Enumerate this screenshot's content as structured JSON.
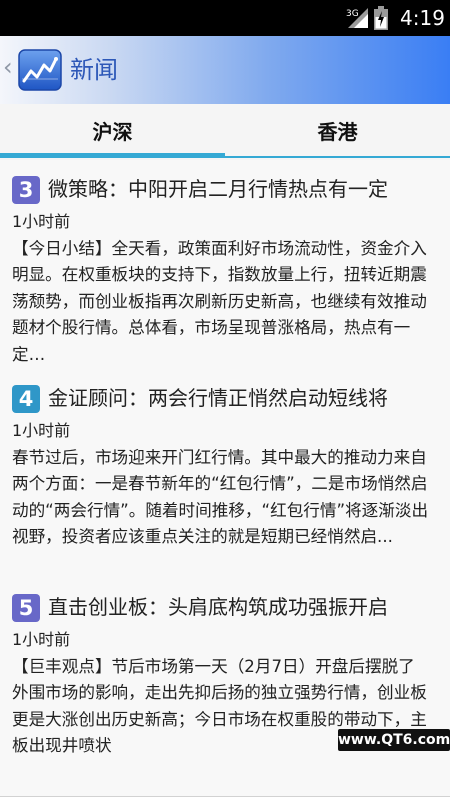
{
  "status_bar": {
    "network": "3G",
    "time": "4:19"
  },
  "header": {
    "title": "新闻",
    "back_icon": "chevron-left-icon",
    "logo_icon": "stock-chart-icon"
  },
  "tabs": [
    {
      "label": "沪深",
      "selected": true
    },
    {
      "label": "香港",
      "selected": false
    }
  ],
  "colors": {
    "tab_indicator": "#35a9d4"
  },
  "news": [
    {
      "number": "3",
      "badge_color": "#6868c8",
      "headline": "微策略：中阳开启二月行情热点有一定",
      "time": "1小时前",
      "summary": "【今日小结】全天看，政策面利好市场流动性，资金介入明显。在权重板块的支持下，指数放量上行，扭转近期震荡颓势，而创业板指再次刷新历史新高，也继续有效推动题材个股行情。总体看，市场呈现普涨格局，热点有一定…"
    },
    {
      "number": "4",
      "badge_color": "#2f97c8",
      "headline": "金证顾问：两会行情正悄然启动短线将",
      "time": "1小时前",
      "summary": "春节过后，市场迎来开门红行情。其中最大的推动力来自两个方面：一是春节新年的“红包行情”，二是市场悄然启动的“两会行情”。随着时间推移，“红包行情”将逐渐淡出视野，投资者应该重点关注的就是短期已经悄然启..."
    },
    {
      "number": "5",
      "badge_color": "#6868c8",
      "headline": "直击创业板：头肩底构筑成功强振开启",
      "time": "1小时前",
      "summary": "【巨丰观点】节后市场第一天（2月7日）开盘后摆脱了外围市场的影响，走出先抑后扬的独立强势行情，创业板更是大涨创出历史新高；今日市场在权重股的带动下，主板出现井喷状"
    }
  ],
  "watermark": "www.QT6.com"
}
